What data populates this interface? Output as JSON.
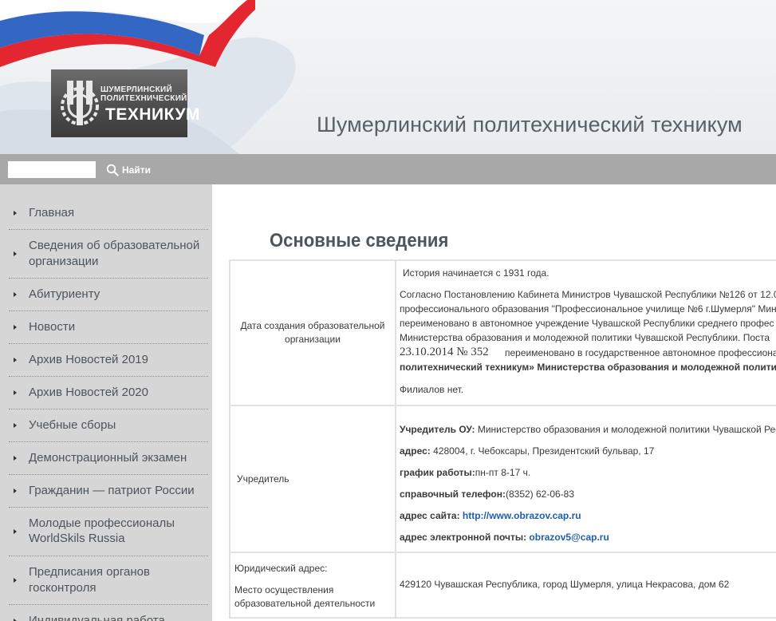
{
  "header": {
    "site_title": "Шумерлинский политехнический техникум",
    "logo": {
      "line1": "ШУМЕРЛИНСКИЙ",
      "line2": "ПОЛИТЕХНИЧЕСКИЙ",
      "line3": "ТЕХНИКУМ"
    },
    "flag_colors": [
      "#ffffff",
      "#2e63b8",
      "#d8202b"
    ]
  },
  "search": {
    "placeholder": "",
    "value": "",
    "button_label": "Найти",
    "icon": "search-icon"
  },
  "sidebar": {
    "items": [
      {
        "label": "Главная"
      },
      {
        "label": "Сведения об образовательной организации",
        "lines": [
          "Сведения об образовательной",
          "организации"
        ]
      },
      {
        "label": "Абитуриенту"
      },
      {
        "label": "Новости"
      },
      {
        "label": "Архив Новостей 2019"
      },
      {
        "label": "Архив Новостей 2020"
      },
      {
        "label": "Учебные сборы"
      },
      {
        "label": "Демонстрационный экзамен"
      },
      {
        "label": "Гражданин — патриот России"
      },
      {
        "label": "Молодые профессионалы WorldSkils Russia",
        "lines": [
          "Молодые профессионалы",
          "WorldSkils Russia"
        ]
      },
      {
        "label": "Предписания органов госконтроля",
        "lines": [
          "Предписания органов",
          "госконтроля"
        ]
      },
      {
        "label": "Индивидуальная работа"
      }
    ]
  },
  "main": {
    "heading": "Основные сведения",
    "table": {
      "row1": {
        "label_lines": [
          "Дата создания образовательной",
          "организации"
        ],
        "history": "История начинается с 1931 года.",
        "lines": [
          "Согласно Постановлению Кабинета Министров Чувашской Республики №126 от 12.0",
          "профессионального образования \"Профессиональное училище №6 г.Шумерля\" Мин",
          "переименовано  в автономное учреждение Чувашской Республики среднего профес",
          "Министерства образования и молодежной политики Чувашской Республики. Поста",
          "23.10.2014  № 352  ",
          "переименовано  в государственное автономное профессиона",
          "политехнический техникум» Министерства образования и молодежной политики Чу"
        ],
        "branches": "Филиалов нет."
      },
      "row2": {
        "label": "Учредитель",
        "founder_label": "Учредитель ОУ:",
        "founder_value": " Министерство образования и молодежной политики Чувашской Рес",
        "address_label": "адрес:",
        "address_value": " 428004, г. Чебоксары, Президентский бульвар, 17",
        "hours_label": "график работы:",
        "hours_value": "пн-пт 8-17 ч.",
        "phone_label": "справочный телефон:",
        "phone_value": "(8352) 62-06-83",
        "site_label": "адрес сайта: ",
        "site_url": "http://www.obrazov.cap.ru",
        "email_label": "адрес электронной почты: ",
        "email_value": "obrazov5@cap.ru"
      },
      "row3": {
        "label_legal": "Юридический адрес:",
        "label_place_lines": [
          "Место осуществления",
          "образовательной деятельности"
        ],
        "value": "429120 Чувашская Республика, город Шумерля, улица Некрасова, дом 62"
      }
    }
  }
}
